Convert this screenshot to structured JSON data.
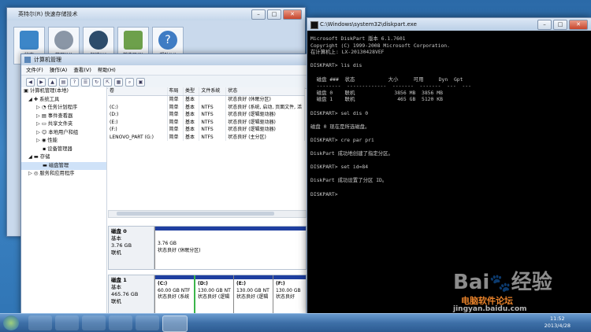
{
  "intel": {
    "title": "英特尔(R) 快速存储技术",
    "tiles": [
      {
        "label": "状态",
        "icon": "status-icon"
      },
      {
        "label": "管理(M)",
        "icon": "gear-icon"
      },
      {
        "label": "加速(A)",
        "icon": "accelerate-icon"
      },
      {
        "label": "首选项(P)",
        "icon": "preferences-icon"
      },
      {
        "label": "帮助(H)",
        "icon": "help-icon"
      }
    ]
  },
  "cm": {
    "title": "计算机管理",
    "menu": [
      "文件(F)",
      "操作(A)",
      "查看(V)",
      "帮助(H)"
    ],
    "tree": [
      {
        "label": "计算机管理(本地)",
        "indent": 0,
        "sel": false
      },
      {
        "label": "系统工具",
        "indent": 1,
        "sel": false
      },
      {
        "label": "任务计划程序",
        "indent": 2,
        "sel": false
      },
      {
        "label": "事件查看器",
        "indent": 2,
        "sel": false
      },
      {
        "label": "共享文件夹",
        "indent": 2,
        "sel": false
      },
      {
        "label": "本地用户和组",
        "indent": 2,
        "sel": false
      },
      {
        "label": "性能",
        "indent": 2,
        "sel": false
      },
      {
        "label": "设备管理器",
        "indent": 2,
        "sel": false
      },
      {
        "label": "存储",
        "indent": 1,
        "sel": false
      },
      {
        "label": "磁盘管理",
        "indent": 2,
        "sel": true
      },
      {
        "label": "服务和应用程序",
        "indent": 1,
        "sel": false
      }
    ],
    "vol_headers": [
      "卷",
      "布局",
      "类型",
      "文件系统",
      "状态"
    ],
    "volumes": [
      [
        "",
        "简单",
        "基本",
        "",
        "状态良好 (休眠分区)"
      ],
      [
        "(C:)",
        "简单",
        "基本",
        "NTFS",
        "状态良好 (系统, 启动, 页面文件, 活"
      ],
      [
        "(D:)",
        "简单",
        "基本",
        "NTFS",
        "状态良好 (逻辑驱动器)"
      ],
      [
        "(E:)",
        "简单",
        "基本",
        "NTFS",
        "状态良好 (逻辑驱动器)"
      ],
      [
        "(F:)",
        "简单",
        "基本",
        "NTFS",
        "状态良好 (逻辑驱动器)"
      ],
      [
        "LENOVO_PART (G:)",
        "简单",
        "基本",
        "NTFS",
        "状态良好 (主分区)"
      ]
    ],
    "disk0": {
      "name": "磁盘 0",
      "type": "基本",
      "size": "3.76 GB",
      "status": "联机",
      "part": {
        "size": "3.76 GB",
        "status": "状态良好 (休眠分区)"
      }
    },
    "disk1": {
      "name": "磁盘 1",
      "type": "基本",
      "size": "465.76 GB",
      "status": "联机",
      "parts": [
        {
          "name": "(C:)",
          "size": "60.00 GB NTF",
          "status": "状态良好 (系统"
        },
        {
          "name": "(D:)",
          "size": "130.00 GB NT",
          "status": "状态良好 (逻辑"
        },
        {
          "name": "(E:)",
          "size": "130.00 GB NT",
          "status": "状态良好 (逻辑"
        },
        {
          "name": "(F:)",
          "size": "130.00 GB",
          "status": "状态良好"
        }
      ]
    }
  },
  "cmd": {
    "title": "C:\\Windows\\system32\\diskpart.exe",
    "lines": [
      "Microsoft DiskPart 版本 6.1.7601",
      "Copyright (C) 1999-2008 Microsoft Corporation.",
      "在计算机上: LX-20130428VEF",
      "",
      "DISKPART> lis dis",
      "",
      "  磁盘 ###  状态           大小     可用     Dyn  Gpt",
      "  --------  -------------  -------  -------  ---  ---",
      "  磁盘 0    联机             3856 MB  3856 MB",
      "  磁盘 1    联机              465 GB  5120 KB",
      "",
      "DISKPART> sel dis 0",
      "",
      "磁盘 0 现在是所选磁盘。",
      "",
      "DISKPART> cre par pri",
      "",
      "DiskPart 成功地创建了指定分区。",
      "",
      "DISKPART> set id=84",
      "",
      "DiskPart 成功设置了分区 ID。",
      "",
      "DISKPART>"
    ]
  },
  "taskbar": {
    "time": "11:52",
    "date": "2013/4/28"
  },
  "watermark": {
    "brand": "Bai",
    "brand2": "经验",
    "site": "jingyan.baidu.com",
    "site2": "电脑软件论坛"
  }
}
